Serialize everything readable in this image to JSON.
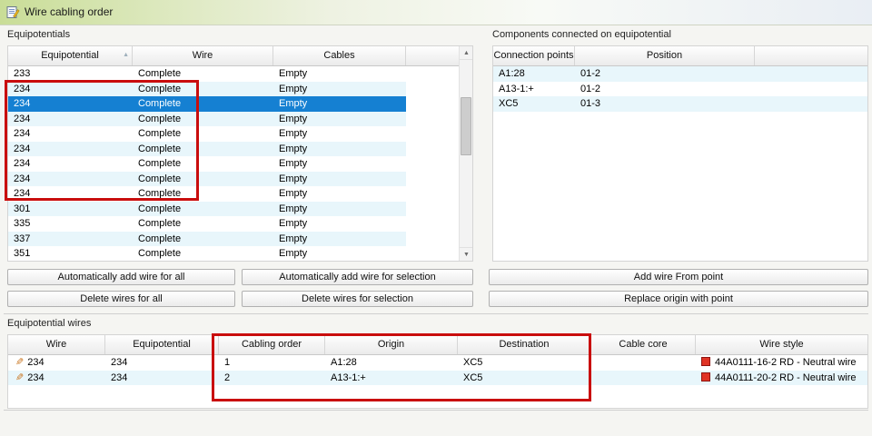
{
  "window": {
    "title": "Wire cabling order"
  },
  "icons": {
    "window_icon": "form-with-pencil",
    "edit_pencil": "✎",
    "sort_ascending": "▲",
    "scroll_up": "▲",
    "scroll_down": "▼"
  },
  "colors": {
    "selection_blue": "#1580d2",
    "annotation_red": "#c90d0d",
    "row_alt": "#e8f6fb"
  },
  "equipotentials": {
    "label": "Equipotentials",
    "columns": [
      "Equipotential",
      "Wire",
      "Cables"
    ],
    "selected_row_index": 2,
    "rows": [
      {
        "equipotential": "233",
        "wire": "Complete",
        "cables": "Empty"
      },
      {
        "equipotential": "234",
        "wire": "Complete",
        "cables": "Empty"
      },
      {
        "equipotential": "234",
        "wire": "Complete",
        "cables": "Empty"
      },
      {
        "equipotential": "234",
        "wire": "Complete",
        "cables": "Empty"
      },
      {
        "equipotential": "234",
        "wire": "Complete",
        "cables": "Empty"
      },
      {
        "equipotential": "234",
        "wire": "Complete",
        "cables": "Empty"
      },
      {
        "equipotential": "234",
        "wire": "Complete",
        "cables": "Empty"
      },
      {
        "equipotential": "234",
        "wire": "Complete",
        "cables": "Empty"
      },
      {
        "equipotential": "234",
        "wire": "Complete",
        "cables": "Empty"
      },
      {
        "equipotential": "301",
        "wire": "Complete",
        "cables": "Empty"
      },
      {
        "equipotential": "335",
        "wire": "Complete",
        "cables": "Empty"
      },
      {
        "equipotential": "337",
        "wire": "Complete",
        "cables": "Empty"
      },
      {
        "equipotential": "351",
        "wire": "Complete",
        "cables": "Empty"
      }
    ],
    "buttons": {
      "add_all": "Automatically add wire for all",
      "add_selection": "Automatically add wire for selection",
      "delete_all": "Delete wires for all",
      "delete_selection": "Delete wires for selection"
    }
  },
  "components": {
    "label": "Components connected on equipotential",
    "columns": [
      "Connection points",
      "Position"
    ],
    "rows": [
      {
        "connection_point": "A1:28",
        "position": "01-2"
      },
      {
        "connection_point": "A13-1:+",
        "position": "01-2"
      },
      {
        "connection_point": "XC5",
        "position": "01-3"
      }
    ],
    "buttons": {
      "add_wire_from_point": "Add wire From point",
      "replace_origin_with_point": "Replace origin with point"
    }
  },
  "wires": {
    "label": "Equipotential wires",
    "columns": [
      "Wire",
      "Equipotential",
      "Cabling order",
      "Origin",
      "Destination",
      "Cable core",
      "Wire style"
    ],
    "rows": [
      {
        "wire": "234",
        "equipotential": "234",
        "cabling_order": "1",
        "origin": "A1:28",
        "destination": "XC5",
        "cable_core": "",
        "wire_style": "44A0111-16-2 RD - Neutral wire"
      },
      {
        "wire": "234",
        "equipotential": "234",
        "cabling_order": "2",
        "origin": "A13-1:+",
        "destination": "XC5",
        "cable_core": "",
        "wire_style": "44A0111-20-2 RD - Neutral wire"
      }
    ]
  }
}
